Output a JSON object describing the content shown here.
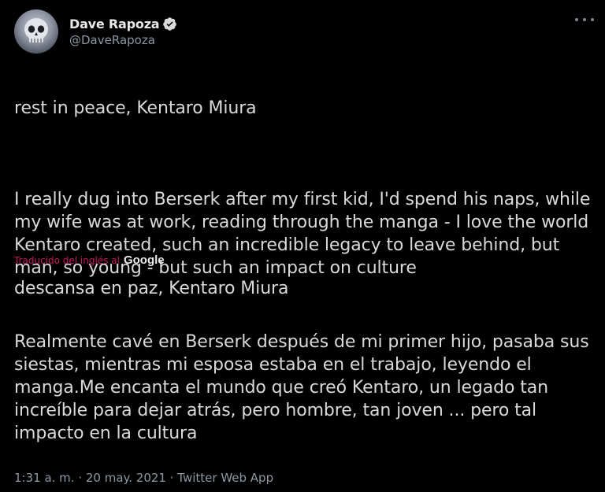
{
  "author": {
    "display_name": "Dave Rapoza",
    "handle": "@DaveRapoza",
    "avatar_icon": "skull-avatar",
    "verified_icon": "verified-badge-icon",
    "verified_color": "#d9d9d9"
  },
  "more_icon": "more-options-icon",
  "tweet": {
    "original_line1": "rest in peace, Kentaro Miura",
    "original_para2": "I really dug into Berserk after my first kid, I'd spend his naps, while my wife was at work, reading through the manga - I love the world Kentaro created, such an incredible legacy to leave behind, but man, so young - but such an impact on culture"
  },
  "translation": {
    "label": "Traducido del inglés al",
    "provider": "Google",
    "label_color": "#c2185b",
    "line1": "descansa en paz, Kentaro Miura",
    "para2": " Realmente cavé en Berserk después de mi primer hijo, pasaba sus siestas, mientras mi esposa estaba en el trabajo, leyendo el manga.Me encanta el mundo que creó Kentaro, un legado tan increíble para dejar atrás, pero hombre, tan joven ... pero tal impacto en la cultura"
  },
  "meta": {
    "timestamp": "1:31 a. m. · 20 may. 2021 · Twitter Web App"
  }
}
